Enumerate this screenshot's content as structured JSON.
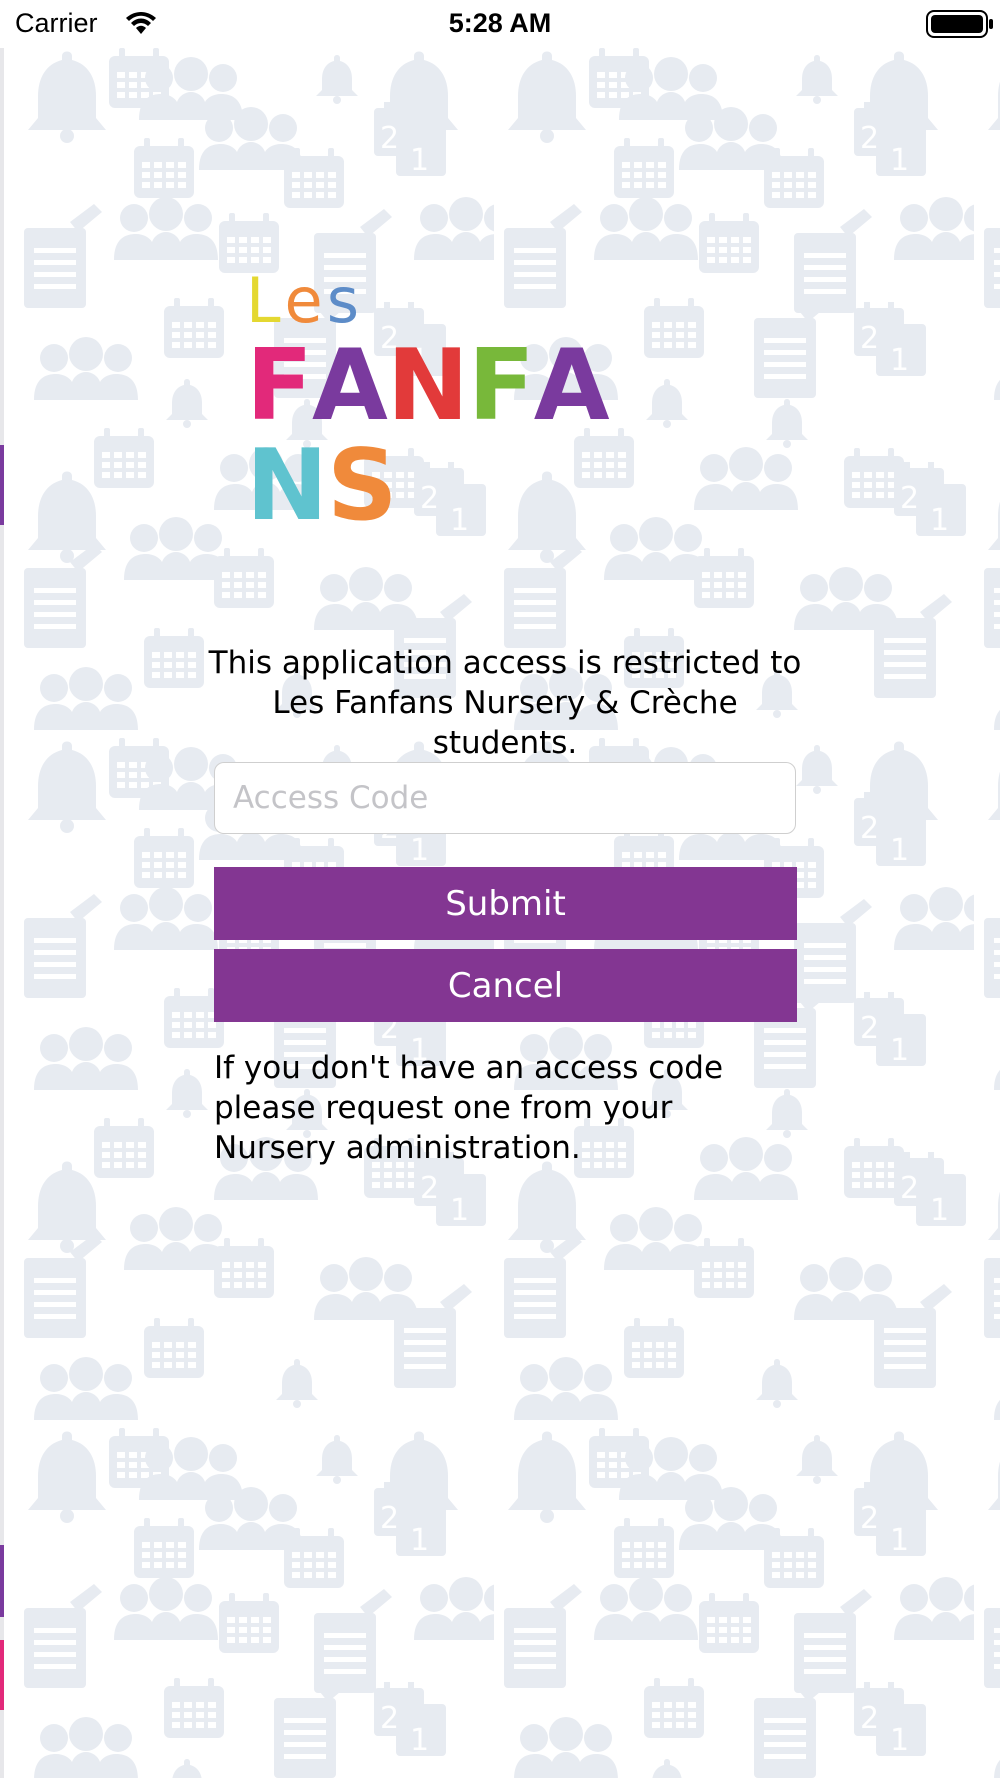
{
  "status_bar": {
    "carrier": "Carrier",
    "time": "5:28 AM",
    "wifi_icon": "wifi-icon",
    "battery_icon": "battery-full-icon"
  },
  "logo": {
    "top_word": "Les",
    "brand": "FANFANS",
    "top_word_colors": [
      "#e4d831",
      "#f08a3b",
      "#5d8cc8"
    ],
    "brand_colors": [
      "#e2297a",
      "#7a3a9e",
      "#e23a3a",
      "#78b83a",
      "#7a3a9e",
      "#5fc3cf",
      "#f08a3b"
    ]
  },
  "intro_text": "This application access is restricted to Les Fanfans Nursery & Crèche students.",
  "access_field": {
    "placeholder": "Access Code",
    "value": ""
  },
  "buttons": {
    "submit": "Submit",
    "cancel": "Cancel"
  },
  "help_text": "If you don't have an access code please request one from your Nursery administration.",
  "colors": {
    "primary_button": "#833692",
    "pattern_icon": "#e7ebf1",
    "background": "#ffffff"
  },
  "background_pattern_icons": [
    "bell-icon",
    "calendar-icon",
    "people-icon",
    "document-icon",
    "calendar-date-icon"
  ]
}
